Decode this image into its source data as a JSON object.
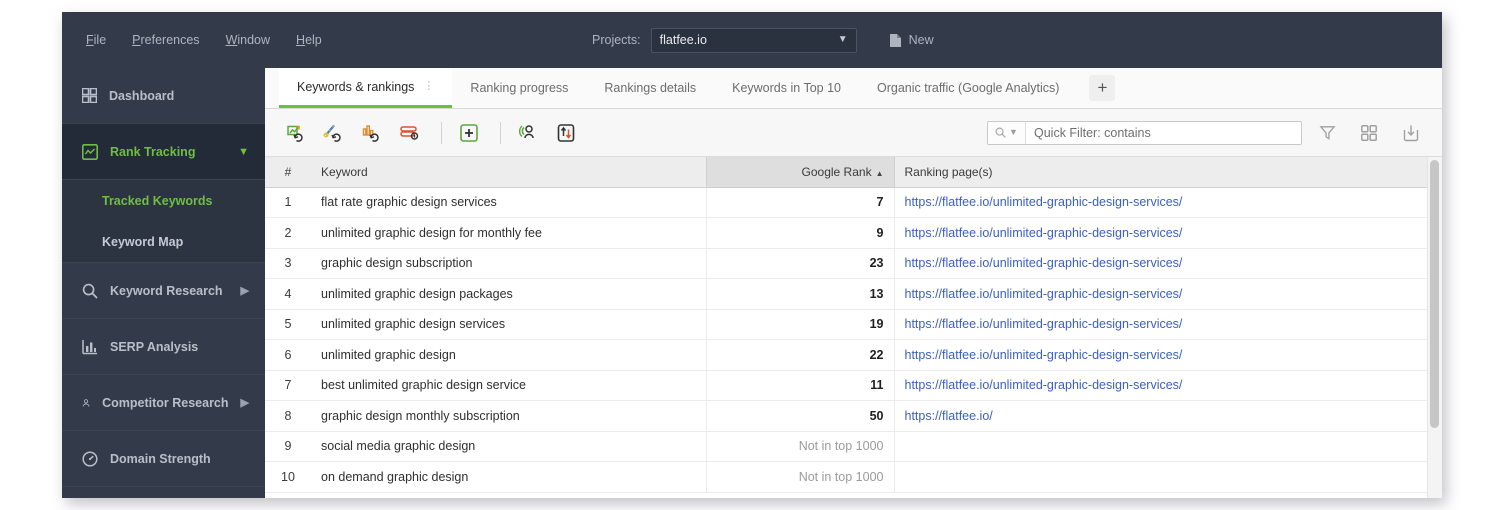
{
  "topbar": {
    "menu": [
      {
        "mnemonic": "F",
        "rest": "ile"
      },
      {
        "mnemonic": "P",
        "rest": "references"
      },
      {
        "mnemonic": "W",
        "rest": "indow"
      },
      {
        "mnemonic": "H",
        "rest": "elp"
      }
    ],
    "projects_label": "Projects:",
    "project_value": "flatfee.io",
    "new_label": "New",
    "new_icon": "document-icon",
    "chevron_icon": "chevron-down-icon"
  },
  "sidebar": {
    "items": [
      {
        "label": "Dashboard",
        "icon": "grid-icon",
        "active": false,
        "chevron": ""
      },
      {
        "label": "Rank Tracking",
        "icon": "chart-box-icon",
        "active": true,
        "chevron": "chevron-down-icon"
      },
      {
        "label": "Keyword Research",
        "icon": "search-icon",
        "active": false,
        "chevron": "chevron-right-icon"
      },
      {
        "label": "SERP Analysis",
        "icon": "bar-chart-icon",
        "active": false,
        "chevron": ""
      },
      {
        "label": "Competitor Research",
        "icon": "person-icon",
        "active": false,
        "chevron": "chevron-right-icon"
      },
      {
        "label": "Domain Strength",
        "icon": "gauge-icon",
        "active": false,
        "chevron": ""
      }
    ],
    "subitems": [
      {
        "label": "Tracked Keywords",
        "selected": true
      },
      {
        "label": "Keyword Map",
        "selected": false
      }
    ]
  },
  "tabs": [
    {
      "label": "Keywords & rankings",
      "active": true,
      "menu_icon": "vertical-dots-icon"
    },
    {
      "label": "Ranking progress",
      "active": false
    },
    {
      "label": "Rankings details",
      "active": false
    },
    {
      "label": "Keywords in Top 10",
      "active": false
    },
    {
      "label": "Organic traffic (Google Analytics)",
      "active": false
    }
  ],
  "tab_add_label": "+",
  "toolbar": {
    "icons": [
      "update-rankings-icon",
      "update-keyword-difficulty-icon",
      "update-search-volume-icon",
      "update-serp-features-icon",
      "add-keywords-icon",
      "competitors-icon",
      "import-export-icon"
    ],
    "right_icons": [
      "filter-icon",
      "grid-view-icon",
      "export-download-icon"
    ]
  },
  "search": {
    "placeholder": "Quick Filter: contains",
    "value": "",
    "icon": "search-icon",
    "chevron": "chevron-down-icon"
  },
  "table": {
    "columns": [
      "#",
      "Keyword",
      "Google Rank",
      "Ranking page(s)"
    ],
    "sorted_column": "Google Rank",
    "sort_direction": "asc",
    "rows": [
      {
        "num": "1",
        "keyword": "flat rate graphic design services",
        "rank": "7",
        "ranked": true,
        "url": "https://flatfee.io/unlimited-graphic-design-services/"
      },
      {
        "num": "2",
        "keyword": "unlimited graphic design for monthly fee",
        "rank": "9",
        "ranked": true,
        "url": "https://flatfee.io/unlimited-graphic-design-services/"
      },
      {
        "num": "3",
        "keyword": "graphic design subscription",
        "rank": "23",
        "ranked": true,
        "url": "https://flatfee.io/unlimited-graphic-design-services/"
      },
      {
        "num": "4",
        "keyword": "unlimited graphic design packages",
        "rank": "13",
        "ranked": true,
        "url": "https://flatfee.io/unlimited-graphic-design-services/"
      },
      {
        "num": "5",
        "keyword": "unlimited graphic design services",
        "rank": "19",
        "ranked": true,
        "url": "https://flatfee.io/unlimited-graphic-design-services/"
      },
      {
        "num": "6",
        "keyword": "unlimited graphic design",
        "rank": "22",
        "ranked": true,
        "url": "https://flatfee.io/unlimited-graphic-design-services/"
      },
      {
        "num": "7",
        "keyword": "best unlimited graphic design service",
        "rank": "11",
        "ranked": true,
        "url": "https://flatfee.io/unlimited-graphic-design-services/"
      },
      {
        "num": "8",
        "keyword": "graphic design monthly subscription",
        "rank": "50",
        "ranked": true,
        "url": "https://flatfee.io/"
      },
      {
        "num": "9",
        "keyword": "social media graphic design",
        "rank": "Not in top 1000",
        "ranked": false,
        "url": ""
      },
      {
        "num": "10",
        "keyword": "on demand graphic design",
        "rank": "Not in top 1000",
        "ranked": false,
        "url": ""
      }
    ]
  },
  "colors": {
    "header_bg": "#333b4a",
    "sidebar_active_bg": "#242b38",
    "accent_green": "#6fbe44",
    "link_blue": "#3b5fc0",
    "muted_text": "#9b9b9b"
  }
}
